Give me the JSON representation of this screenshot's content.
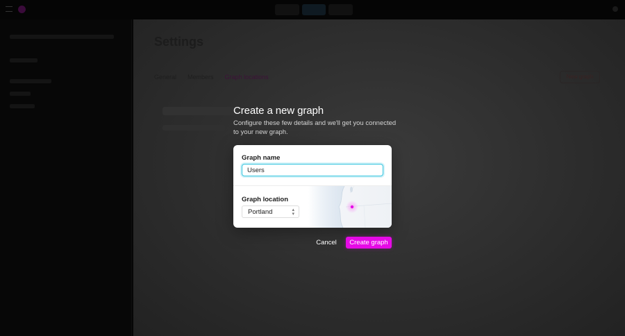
{
  "colors": {
    "accent": "#e60ae6",
    "focus_ring": "#35c4df",
    "modal_card": "#ffffff",
    "overlay_text": "#ffffff"
  },
  "background": {
    "page_title": "Settings",
    "action_button": "New graph",
    "tabs": [
      {
        "label": "General"
      },
      {
        "label": "Members"
      },
      {
        "label": "Graph locations"
      }
    ]
  },
  "modal": {
    "title": "Create a new graph",
    "description": "Configure these few details and we'll get you connected to your new graph.",
    "graph_name_label": "Graph name",
    "graph_name_value": "Users",
    "graph_location_label": "Graph location",
    "graph_location_value": "Portland",
    "location_select_icon": "chevron-up-down-icon",
    "map_icon": "location-pin-icon"
  },
  "actions": {
    "cancel_label": "Cancel",
    "create_label": "Create graph"
  }
}
